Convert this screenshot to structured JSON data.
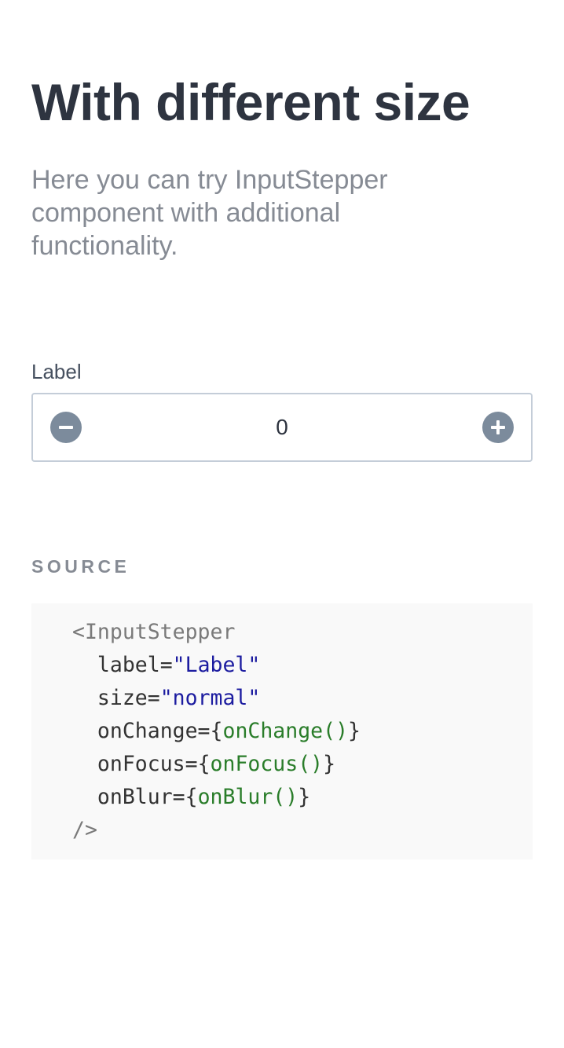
{
  "header": {
    "title": "With different size",
    "description": "Here you can try InputStepper component with additional functionality."
  },
  "stepper": {
    "label": "Label",
    "value": "0",
    "decrement_icon": "minus-circle-icon",
    "increment_icon": "plus-circle-icon",
    "border_color": "#c4cdd8",
    "button_color": "#7c8b9c"
  },
  "source": {
    "heading": "SOURCE",
    "lines": {
      "open_tag": "<InputStepper",
      "label_attr": "label=",
      "label_val": "\"Label\"",
      "size_attr": "size=",
      "size_val": "\"normal\"",
      "onchange_attr": "onChange=",
      "onchange_open": "{",
      "onchange_val": "onChange()",
      "onchange_close": "}",
      "onfocus_attr": "onFocus=",
      "onfocus_open": "{",
      "onfocus_val": "onFocus()",
      "onfocus_close": "}",
      "onblur_attr": "onBlur=",
      "onblur_open": "{",
      "onblur_val": "onBlur()",
      "onblur_close": "}",
      "close_tag": "/>"
    },
    "colors": {
      "tag": "#7a7a7a",
      "string": "#1c1ca0",
      "expression": "#2a7d2a",
      "background": "#f9f9f9"
    }
  }
}
